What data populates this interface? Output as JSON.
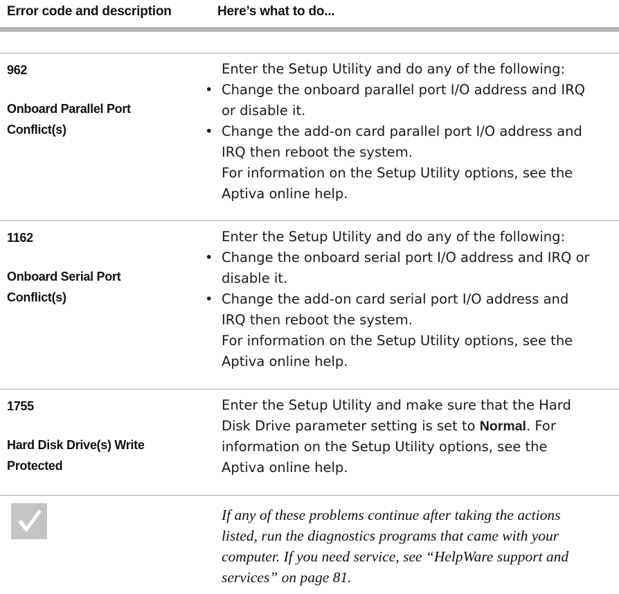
{
  "header": {
    "col_code": "Error code and description",
    "col_action": "Here’s what to do..."
  },
  "rows": [
    {
      "code": "962",
      "description_lines": [
        "Onboard Parallel Port",
        "Conflict(s)"
      ],
      "action_intro": "Enter the Setup Utility and do any of the following:",
      "bullets": [
        [
          "Change the onboard parallel port I/O address and IRQ",
          "or disable it."
        ],
        [
          "Change the add-on card parallel port I/O address and",
          "IRQ then reboot the system."
        ]
      ],
      "footer_lines": [
        "For information on the Setup Utility options, see the",
        "Aptiva online help."
      ]
    },
    {
      "code": "1162",
      "description_lines": [
        "Onboard Serial Port",
        "Conflict(s)"
      ],
      "action_intro": "Enter the Setup Utility and do any of the following:",
      "bullets": [
        [
          "Change the onboard serial port I/O address and IRQ or",
          "disable it."
        ],
        [
          "Change the add-on card serial port I/O address and",
          "IRQ then reboot the system."
        ]
      ],
      "footer_lines": [
        "For information on the Setup Utility options, see the",
        "Aptiva online help."
      ]
    },
    {
      "code": "1755",
      "description_lines": [
        "Hard Disk Drive(s) Write",
        "Protected"
      ],
      "action_lines": [
        [
          "Enter the Setup Utility and make sure that the Hard"
        ],
        [
          "Disk Drive parameter setting is set to ",
          "Normal",
          ". For"
        ],
        [
          "information on the Setup Utility options, see the"
        ],
        [
          "Aptiva online help."
        ]
      ]
    }
  ],
  "bullet_char": "•",
  "note": {
    "icon": "checkmark-icon",
    "lines": [
      "If any of these problems continue after taking the actions",
      "listed, run the diagnostics programs that came with your",
      "computer. If you need service, see “HelpWare support and",
      "services” on page 81."
    ]
  },
  "colors": {
    "header_rule": "#b7b7b7",
    "row_rule": "#a8a8a8",
    "note_icon_bg": "#c4c4c4"
  }
}
